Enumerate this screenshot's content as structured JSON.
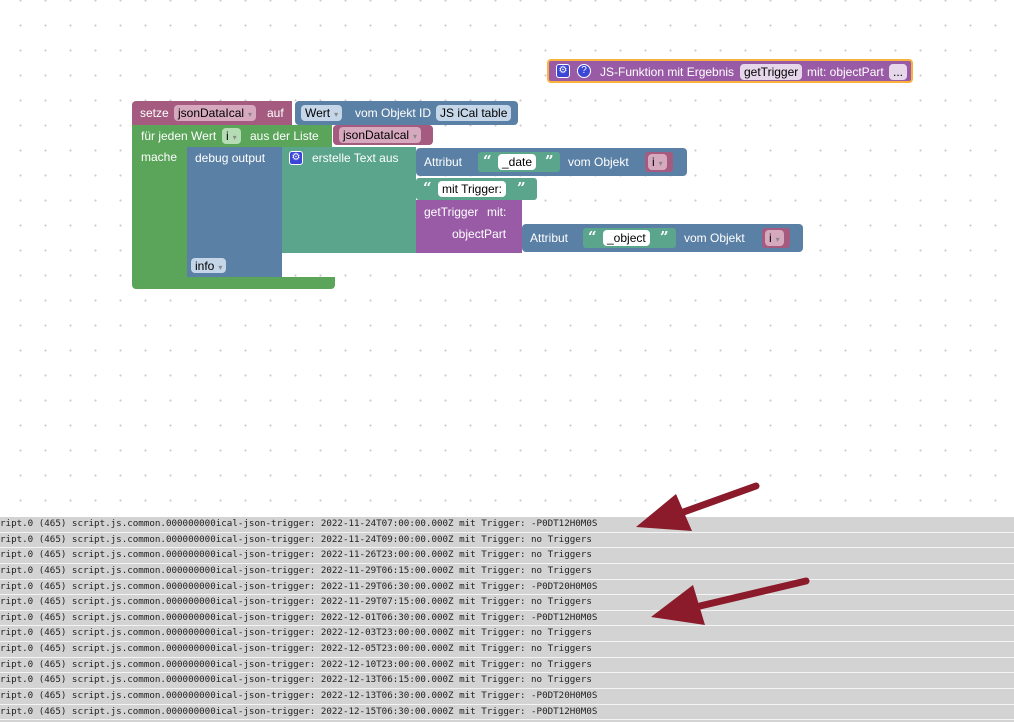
{
  "function_block": {
    "label": "JS-Funktion mit Ergebnis",
    "name": "getTrigger",
    "param": "mit: objectPart",
    "more": "..."
  },
  "set_block": {
    "label": "setze",
    "variable": "jsonDataIcal",
    "to": "auf",
    "value_dd": "Wert",
    "from_object": "vom Objekt ID",
    "object_id": "JS iCal table"
  },
  "foreach_block": {
    "label": "für jeden Wert",
    "var": "i",
    "from_list": "aus der Liste",
    "list": "jsonDataIcal",
    "do": "mache"
  },
  "debug_block": {
    "label": "debug output",
    "level": "info"
  },
  "text_block": {
    "label": "erstelle Text aus"
  },
  "attr_date": {
    "label": "Attribut",
    "value": "_date",
    "from": "vom Objekt",
    "var": "i"
  },
  "text_trigger": {
    "value": "mit Trigger: "
  },
  "call_block": {
    "label": "getTrigger",
    "with": "mit:",
    "param": "objectPart"
  },
  "attr_object": {
    "label": "Attribut",
    "value": "_object",
    "from": "vom Objekt",
    "var": "i"
  },
  "console": {
    "lines": [
      "ript.0 (465) script.js.common.000000000ical-json-trigger: 2022-11-24T07:00:00.000Z mit Trigger: -P0DT12H0M0S",
      "ript.0 (465) script.js.common.000000000ical-json-trigger: 2022-11-24T09:00:00.000Z mit Trigger: no Triggers",
      "ript.0 (465) script.js.common.000000000ical-json-trigger: 2022-11-26T23:00:00.000Z mit Trigger: no Triggers",
      "ript.0 (465) script.js.common.000000000ical-json-trigger: 2022-11-29T06:15:00.000Z mit Trigger: no Triggers",
      "ript.0 (465) script.js.common.000000000ical-json-trigger: 2022-11-29T06:30:00.000Z mit Trigger: -P0DT20H0M0S",
      "ript.0 (465) script.js.common.000000000ical-json-trigger: 2022-11-29T07:15:00.000Z mit Trigger: no Triggers",
      "ript.0 (465) script.js.common.000000000ical-json-trigger: 2022-12-01T06:30:00.000Z mit Trigger: -P0DT12H0M0S",
      "ript.0 (465) script.js.common.000000000ical-json-trigger: 2022-12-03T23:00:00.000Z mit Trigger: no Triggers",
      "ript.0 (465) script.js.common.000000000ical-json-trigger: 2022-12-05T23:00:00.000Z mit Trigger: no Triggers",
      "ript.0 (465) script.js.common.000000000ical-json-trigger: 2022-12-10T23:00:00.000Z mit Trigger: no Triggers",
      "ript.0 (465) script.js.common.000000000ical-json-trigger: 2022-12-13T06:15:00.000Z mit Trigger: no Triggers",
      "ript.0 (465) script.js.common.000000000ical-json-trigger: 2022-12-13T06:30:00.000Z mit Trigger: -P0DT20H0M0S",
      "ript.0 (465) script.js.common.000000000ical-json-trigger: 2022-12-15T06:30:00.000Z mit Trigger: -P0DT12H0M0S"
    ]
  },
  "colors": {
    "variables": "#a55b80",
    "loops": "#5ba55b",
    "debug": "#5b80a5",
    "text": "#5ba58c",
    "functions": "#995ba5",
    "arrow": "#8b1a2a",
    "highlight": "#fbb13c"
  }
}
